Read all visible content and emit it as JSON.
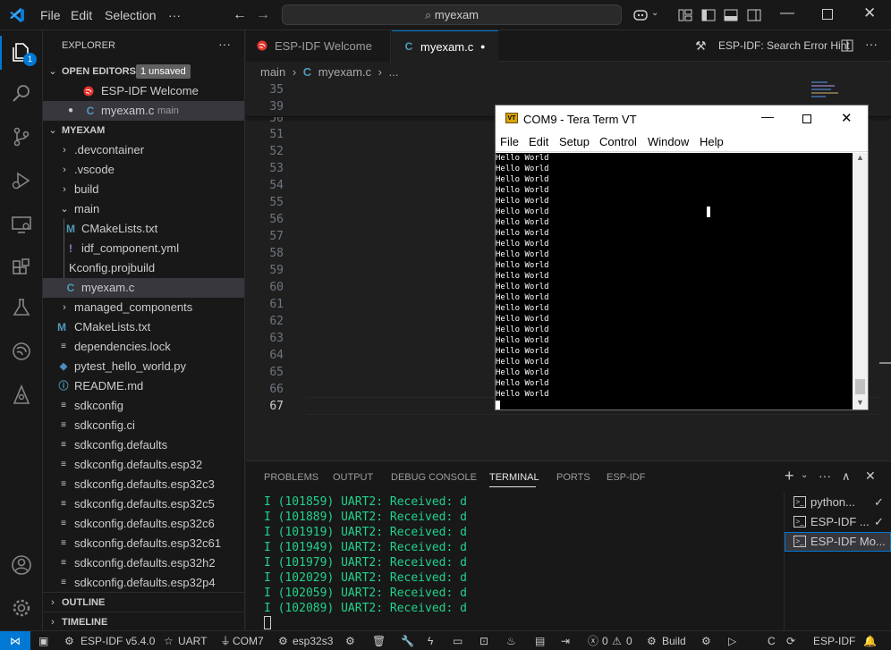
{
  "titlebar": {
    "menu": [
      "File",
      "Edit",
      "Selection"
    ],
    "more": "···",
    "search_text": "myexam"
  },
  "activity_bar": {
    "explorer_badge": "1",
    "icons": [
      "files-icon",
      "search-icon",
      "source-control-icon",
      "run-debug-icon",
      "remote-explorer-icon",
      "extensions-icon",
      "testing-icon",
      "esp-idf-icon",
      "platformio-icon",
      "account-icon",
      "settings-gear-icon"
    ]
  },
  "sidebar": {
    "title": "EXPLORER",
    "more": "···",
    "open_editors": {
      "header": "OPEN EDITORS",
      "badge": "1 unsaved",
      "items": [
        {
          "label": "ESP-IDF Welcome",
          "desc": ""
        },
        {
          "label": "myexam.c",
          "desc": "main"
        }
      ]
    },
    "project": {
      "header": "MYEXAM",
      "items": [
        {
          "label": ".devcontainer",
          "type": "folder"
        },
        {
          "label": ".vscode",
          "type": "folder"
        },
        {
          "label": "build",
          "type": "folder"
        },
        {
          "label": "main",
          "type": "folder-open"
        },
        {
          "label": "CMakeLists.txt",
          "type": "cmake"
        },
        {
          "label": "idf_component.yml",
          "type": "yml"
        },
        {
          "label": "Kconfig.projbuild",
          "type": "text"
        },
        {
          "label": "myexam.c",
          "type": "c"
        },
        {
          "label": "managed_components",
          "type": "folder"
        },
        {
          "label": "CMakeLists.txt",
          "type": "cmake"
        },
        {
          "label": "dependencies.lock",
          "type": "text"
        },
        {
          "label": "pytest_hello_world.py",
          "type": "python"
        },
        {
          "label": "README.md",
          "type": "info"
        },
        {
          "label": "sdkconfig",
          "type": "text"
        },
        {
          "label": "sdkconfig.ci",
          "type": "text"
        },
        {
          "label": "sdkconfig.defaults",
          "type": "text"
        },
        {
          "label": "sdkconfig.defaults.esp32",
          "type": "text"
        },
        {
          "label": "sdkconfig.defaults.esp32c3",
          "type": "text"
        },
        {
          "label": "sdkconfig.defaults.esp32c5",
          "type": "text"
        },
        {
          "label": "sdkconfig.defaults.esp32c6",
          "type": "text"
        },
        {
          "label": "sdkconfig.defaults.esp32c61",
          "type": "text"
        },
        {
          "label": "sdkconfig.defaults.esp32h2",
          "type": "text"
        },
        {
          "label": "sdkconfig.defaults.esp32p4",
          "type": "text"
        }
      ]
    },
    "outline": "OUTLINE",
    "timeline": "TIMELINE"
  },
  "tabs": {
    "items": [
      {
        "label": "ESP-IDF Welcome"
      },
      {
        "label": "myexam.c"
      }
    ],
    "right_action": "ESP-IDF: Search Error Hint"
  },
  "breadcrumb": {
    "folder": "main",
    "file": "myexam.c",
    "more": "..."
  },
  "editor": {
    "sticky_lines": [
      "35",
      "39"
    ],
    "line_numbers": [
      "50",
      "51",
      "52",
      "53",
      "54",
      "55",
      "56",
      "57",
      "58",
      "59",
      "60",
      "61",
      "62",
      "63",
      "64",
      "65",
      "66",
      "67"
    ]
  },
  "teraterm": {
    "title": "COM9 - Tera Term VT",
    "logo": "VT",
    "menu": [
      "File",
      "Edit",
      "Setup",
      "Control",
      "Window",
      "Help"
    ],
    "lines": [
      "Hello World",
      "Hello World",
      "Hello World",
      "Hello World",
      "Hello World",
      "Hello World",
      "Hello World",
      "Hello World",
      "Hello World",
      "Hello World",
      "Hello World",
      "Hello World",
      "Hello World",
      "Hello World",
      "Hello World",
      "Hello World",
      "Hello World",
      "Hello World",
      "Hello World",
      "Hello World",
      "Hello World",
      "Hello World",
      "Hello World"
    ]
  },
  "panel": {
    "tabs": [
      "PROBLEMS",
      "OUTPUT",
      "DEBUG CONSOLE",
      "TERMINAL",
      "PORTS",
      "ESP-IDF"
    ],
    "active_tab": "TERMINAL",
    "terminal_lines": [
      "I (101859) UART2: Received: d",
      "I (101889) UART2: Received: d",
      "I (101919) UART2: Received: d",
      "I (101949) UART2: Received: d",
      "I (101979) UART2: Received: d",
      "I (102029) UART2: Received: d",
      "I (102059) UART2: Received: d",
      "I (102089) UART2: Received: d"
    ],
    "terminal_list": [
      "python...",
      "ESP-IDF ...",
      "ESP-IDF Mo..."
    ]
  },
  "statusbar": {
    "esp_idf_version": "ESP-IDF v5.4.0",
    "uart": "UART",
    "port": "COM7",
    "target": "esp32s3",
    "errors": "0",
    "warnings": "0",
    "build": "Build",
    "lang": "C",
    "esp_idf": "ESP-IDF"
  },
  "colors": {
    "accent": "#0078d4",
    "terminal_green": "#23d18b",
    "espressif_red": "#e7352c"
  }
}
